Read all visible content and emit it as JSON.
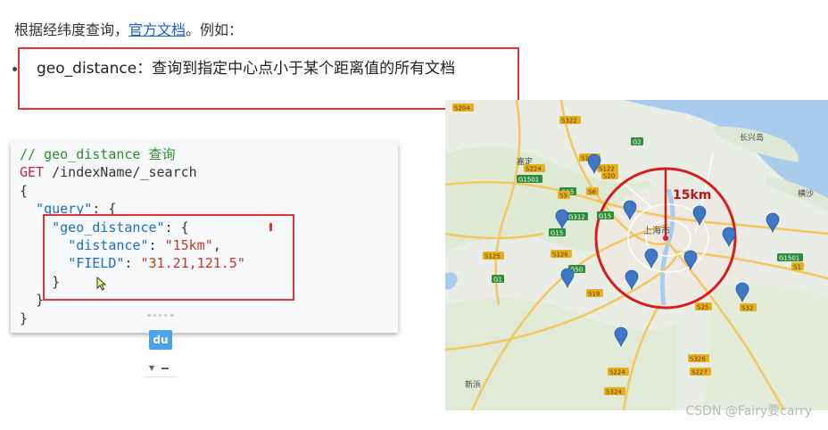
{
  "intro": {
    "prefix": "根据经纬度查询，",
    "link": "官方文档",
    "suffix": "。例如："
  },
  "bullet": {
    "text": "geo_distance：查询到指定中心点小于某个距离值的所有文档"
  },
  "code": {
    "comment": "// geo_distance 查询",
    "method": "GET",
    "path": " /indexName/_search",
    "open_brace": "{",
    "query_key": "\"query\"",
    "geo_key": "\"geo_distance\"",
    "distance_key": "\"distance\"",
    "distance_val": "\"15km\"",
    "field_key": "\"FIELD\"",
    "field_val": "\"31.21,121.5\"",
    "close_brace": "}"
  },
  "widget": {
    "logo_text": "du"
  },
  "map": {
    "radius_label": "15km",
    "city_label": "上海市",
    "place_labels": {
      "changxing": "长兴岛",
      "hengsha": "横沙",
      "jiading": "嘉定",
      "xinbin": "新浜"
    },
    "road_badges": [
      "S204",
      "S106",
      "S122",
      "S322",
      "G2",
      "S224",
      "G1501",
      "G15",
      "S6",
      "S5",
      "G15",
      "G312",
      "S20",
      "S125",
      "S126",
      "G1501",
      "G50",
      "S19",
      "S25",
      "S32",
      "S326",
      "S224",
      "S227",
      "S324",
      "G1",
      "G15",
      "S1"
    ],
    "circle_color": "#d61d1d",
    "marker_color": "#3f78c7"
  },
  "watermark": "CSDN @Fairy要carry"
}
